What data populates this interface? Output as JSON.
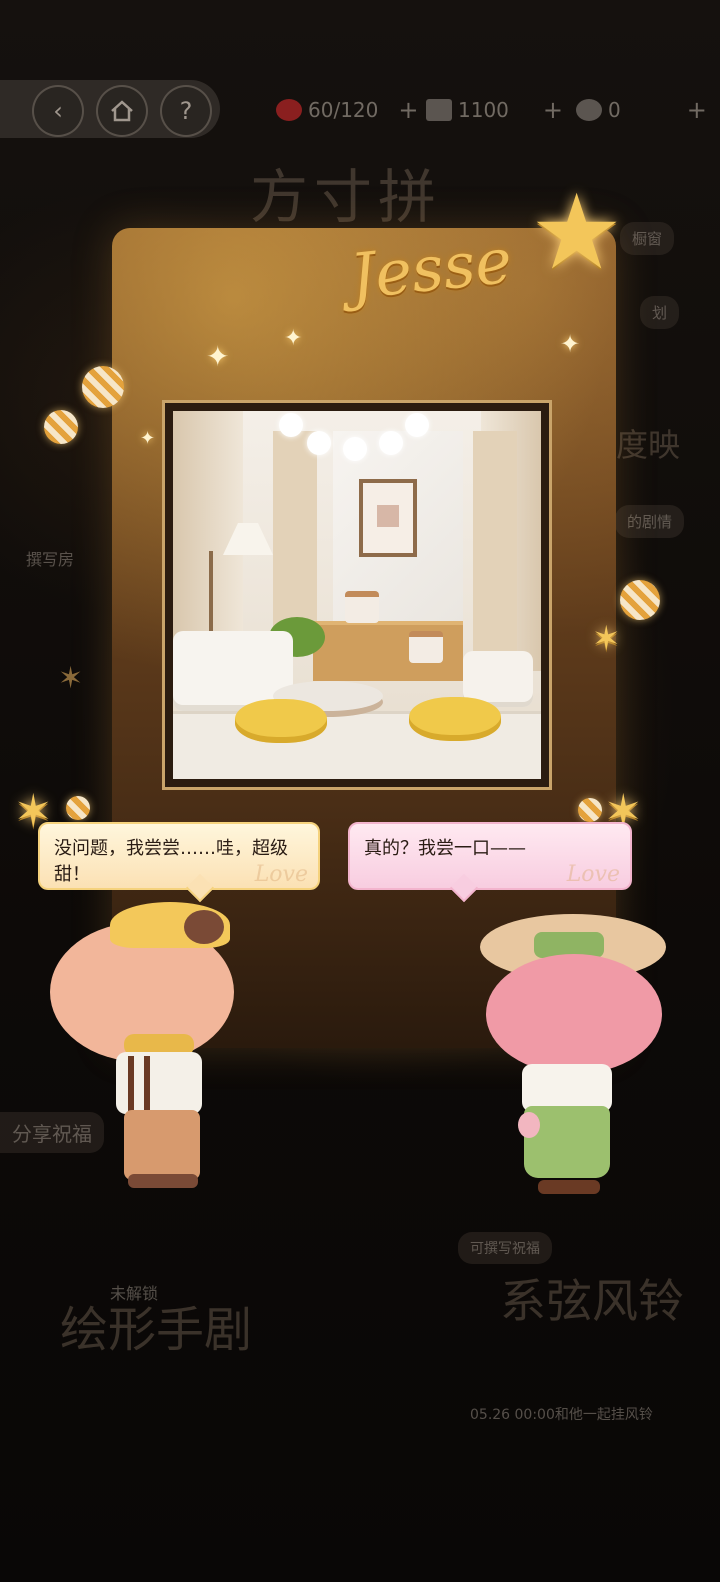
{
  "topbar": {
    "back_icon": "chevron-left-icon",
    "home_icon": "home-icon",
    "help_label": "?",
    "stamina": "60/120",
    "coins": "1100",
    "gems": "0"
  },
  "card": {
    "signature": "Jesse"
  },
  "dialogue": {
    "left_text": "没问题，我尝尝……哇，超级甜！",
    "right_text": "真的？我尝一口——",
    "left_watermark": "Love",
    "right_watermark": "Love"
  },
  "background": {
    "title_faint": "方寸拼",
    "side_button_1": "橱窗",
    "side_button_2": "划",
    "side_button_3": "度映",
    "side_button_4": "的剧情",
    "left_label": "撰写房",
    "share_label": "分享祝福",
    "locked_label": "未解锁",
    "script_title": "绘形手剧",
    "wind_chime_tag": "可撰写祝福",
    "wind_chime_title": "系弦风铃",
    "wind_chime_date": "05.26 00:00和他一起挂风铃"
  },
  "colors": {
    "gold": "#f0c060",
    "card_brown": "#6b431e",
    "bubble_yellow": "#fbe1b4",
    "bubble_pink": "#f8cde0"
  }
}
